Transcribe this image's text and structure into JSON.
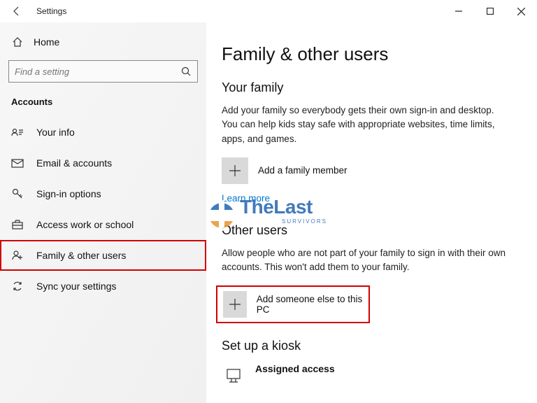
{
  "window": {
    "title": "Settings"
  },
  "sidebar": {
    "home": "Home",
    "search_placeholder": "Find a setting",
    "category": "Accounts",
    "items": [
      {
        "label": "Your info"
      },
      {
        "label": "Email & accounts"
      },
      {
        "label": "Sign-in options"
      },
      {
        "label": "Access work or school"
      },
      {
        "label": "Family & other users"
      },
      {
        "label": "Sync your settings"
      }
    ]
  },
  "content": {
    "page_title": "Family & other users",
    "family": {
      "title": "Your family",
      "text": "Add your family so everybody gets their own sign-in and desktop. You can help kids stay safe with appropriate websites, time limits, apps, and games.",
      "add_label": "Add a family member",
      "learn_more": "Learn more"
    },
    "other": {
      "title": "Other users",
      "text": "Allow people who are not part of your family to sign in with their own accounts. This won't add them to your family.",
      "add_label": "Add someone else to this PC"
    },
    "kiosk": {
      "title": "Set up a kiosk",
      "row_title": "Assigned access"
    }
  },
  "watermark": {
    "brand": "TheLast",
    "sub": "SURVIVORS"
  }
}
